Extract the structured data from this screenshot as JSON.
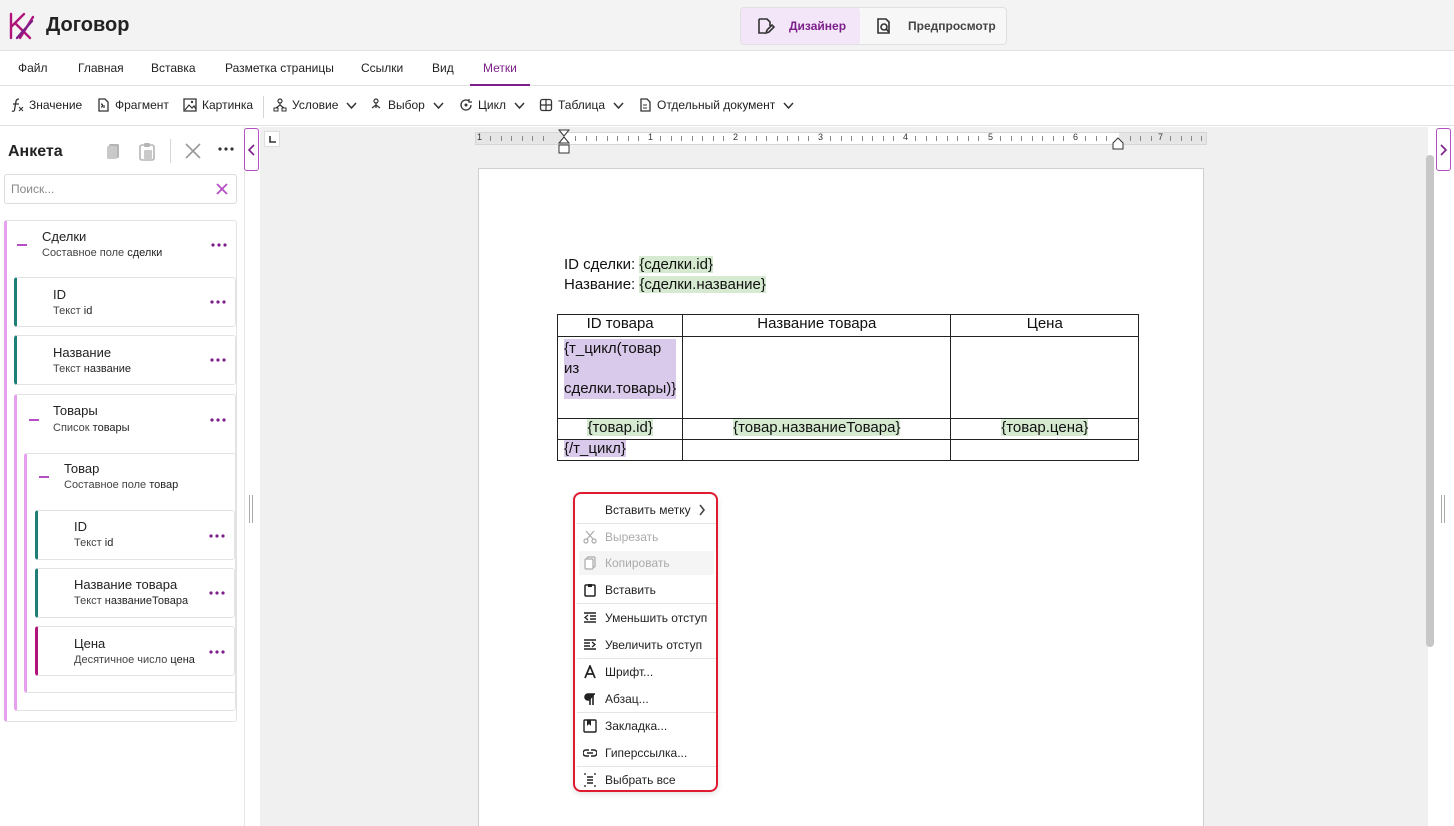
{
  "app": {
    "title": "Договор"
  },
  "modes": {
    "designer": "Дизайнер",
    "preview": "Предпросмотр",
    "active": "designer"
  },
  "menu_tabs": [
    "Файл",
    "Главная",
    "Вставка",
    "Разметка страницы",
    "Ссылки",
    "Вид",
    "Метки"
  ],
  "active_tab": "Метки",
  "ribbon": {
    "value": "Значение",
    "fragment": "Фрагмент",
    "picture": "Картинка",
    "condition": "Условие",
    "choice": "Выбор",
    "loop": "Цикл",
    "table": "Таблица",
    "separate_doc": "Отдельный документ"
  },
  "panel": {
    "title": "Анкета",
    "search_placeholder": "Поиск...",
    "tree": {
      "deals": {
        "name": "Сделки",
        "type": "Составное поле",
        "field": "сделки"
      },
      "deal_id": {
        "name": "ID",
        "type": "Текст",
        "field": "id"
      },
      "deal_name": {
        "name": "Название",
        "type": "Текст",
        "field": "название"
      },
      "goods": {
        "name": "Товары",
        "type": "Список",
        "field": "товары"
      },
      "good": {
        "name": "Товар",
        "type": "Составное поле",
        "field": "товар"
      },
      "good_id": {
        "name": "ID",
        "type": "Текст",
        "field": "id"
      },
      "good_name": {
        "name": "Название товара",
        "type": "Текст",
        "field": "названиеТовара"
      },
      "good_price": {
        "name": "Цена",
        "type": "Десятичное число",
        "field": "цена"
      }
    }
  },
  "ruler": {
    "numbers": [
      "1",
      "1",
      "2",
      "3",
      "4",
      "5",
      "6",
      "7"
    ]
  },
  "document": {
    "line1_label": "ID сделки: ",
    "line1_tag": "{сделки.id}",
    "line2_label": "Название: ",
    "line2_tag": "{сделки.название}",
    "table": {
      "headers": [
        "ID товара",
        "Название товара",
        "Цена"
      ],
      "loop_start": "{т_цикл(товар из сделки.товары)}",
      "row_tags": [
        "{товар.id}",
        "{товар.названиеТовара}",
        "{товар.цена}"
      ],
      "loop_end": "{/т_цикл}"
    }
  },
  "context_menu": {
    "insert_tag": "Вставить метку",
    "cut": "Вырезать",
    "copy": "Копировать",
    "paste": "Вставить",
    "decrease_indent": "Уменьшить отступ",
    "increase_indent": "Увеличить отступ",
    "font": "Шрифт...",
    "paragraph": "Абзац...",
    "bookmark": "Закладка...",
    "hyperlink": "Гиперссылка...",
    "select_all": "Выбрать все"
  },
  "colors": {
    "accent": "#7d1f8a",
    "tag_green": "#d5ead0",
    "tag_purple": "#d9c9ea",
    "menu_border": "#e01b2f",
    "teal": "#1f7f76",
    "magenta": "#b0147a"
  }
}
